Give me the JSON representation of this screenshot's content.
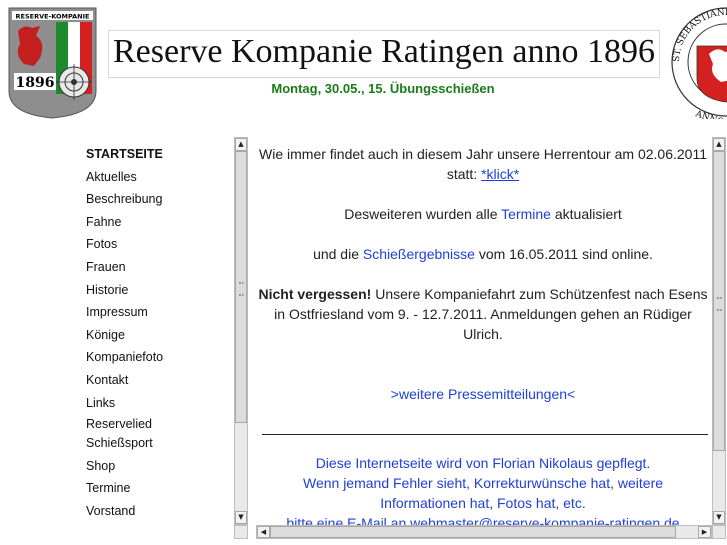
{
  "header": {
    "title": "Reserve Kompanie Ratingen anno 1896",
    "subtitle": "Montag, 30.05., 15. Übungsschießen",
    "logo_left": {
      "banner": "RESERVE-KOMPANIE",
      "year": "1896"
    },
    "logo_right": {
      "ring_text": "ST. SEBASTIANI BRUD",
      "bottom_text": "ANNO"
    }
  },
  "nav": {
    "items": [
      "STARTSEITE",
      "Aktuelles",
      "Beschreibung",
      "Fahne",
      "Fotos",
      "Frauen",
      "Historie",
      "Impressum",
      "Könige",
      "Kompaniefoto",
      "Kontakt",
      "Links",
      "Reservelied",
      "Schießsport",
      "Shop",
      "Termine",
      "Vorstand"
    ]
  },
  "content": {
    "p1_text": "Wie immer findet auch in diesem Jahr unsere Herrentour am 02.06.2011 statt:",
    "p1_link": "*klick*",
    "p2_pre": "Desweiteren wurden alle",
    "p2_link": "Termine",
    "p2_post": "aktualisiert",
    "p3_pre": "und die",
    "p3_link": "Schießergebnisse",
    "p3_post": "vom 16.05.2011 sind online.",
    "p4_bold": "Nicht vergessen!",
    "p4_text": "Unsere Kompaniefahrt zum Schützenfest nach Esens in Ostfriesland vom 9. - 12.7.2011. Anmeldungen gehen an Rüdiger Ulrich.",
    "press_link": ">weitere Pressemitteilungen<",
    "footer_lines": [
      "Diese Internetseite wird von Florian Nikolaus gepflegt.",
      "Wenn jemand Fehler sieht, Korrekturwünsche hat, weitere",
      "Informationen hat, Fotos hat, etc.",
      "bitte eine E-Mail an webmaster@reserve-kompanie-ratingen.de"
    ]
  },
  "colors": {
    "green": "#1a7a1a",
    "link_blue": "#1f3fd6"
  }
}
